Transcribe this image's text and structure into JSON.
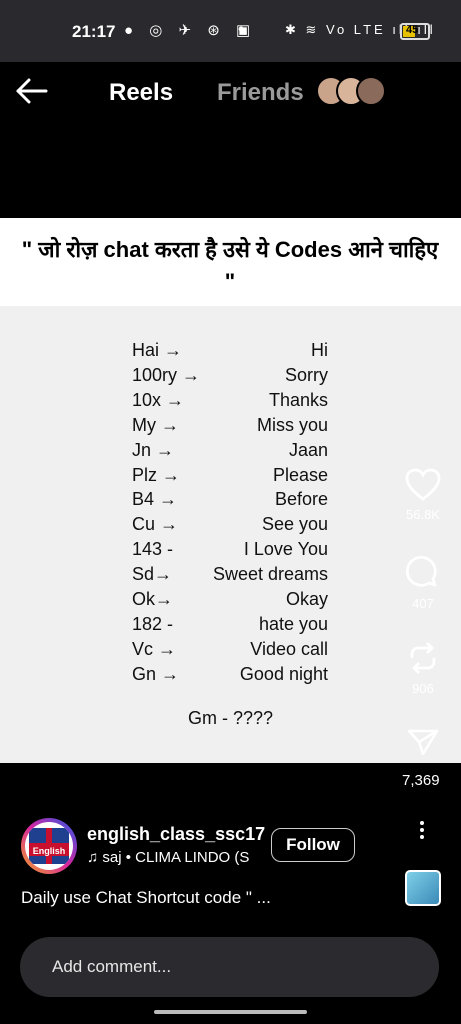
{
  "status": {
    "time": "21:17",
    "left_icons": "● ◎ ✈ ⊛ ▣",
    "right_icons": "✱ ≋ Vo LTE ıll ıll",
    "battery": "45"
  },
  "header": {
    "tab_reels": "Reels",
    "tab_friends": "Friends",
    "friend_avatar_colors": [
      "#c9a38a",
      "#d8b49b",
      "#8a6a5a"
    ]
  },
  "reel": {
    "title": "\" जो रोज़ chat करता है उसे ये  Codes आने चाहिए \"",
    "codes": [
      {
        "key": "Hai →",
        "value": "Hi"
      },
      {
        "key": "100ry →",
        "value": "Sorry"
      },
      {
        "key": "10x →",
        "value": "Thanks"
      },
      {
        "key": "My →",
        "value": "Miss you"
      },
      {
        "key": "Jn →",
        "value": "Jaan"
      },
      {
        "key": "Plz →",
        "value": "Please"
      },
      {
        "key": "B4 →",
        "value": "Before"
      },
      {
        "key": "Cu →",
        "value": "See you"
      },
      {
        "key": "143 -",
        "value": "I Love You"
      },
      {
        "key": "Sd→",
        "value": "Sweet dreams"
      },
      {
        "key": "Ok→",
        "value": "Okay"
      },
      {
        "key": "182 -",
        "value": "hate you"
      },
      {
        "key": "Vc →",
        "value": "Video call"
      },
      {
        "key": "Gn →",
        "value": "Good night"
      }
    ],
    "footer": "Gm - ????"
  },
  "actions": {
    "likes": "56.8K",
    "comments": "407",
    "remixes": "906",
    "shares": "7,369"
  },
  "post": {
    "username": "english_class_ssc17",
    "profile_label": "English",
    "music": "saj • CLIMA LINDO (S",
    "follow_label": "Follow",
    "caption": "Daily use Chat Shortcut code \" ..."
  },
  "comment": {
    "placeholder": "Add comment..."
  }
}
